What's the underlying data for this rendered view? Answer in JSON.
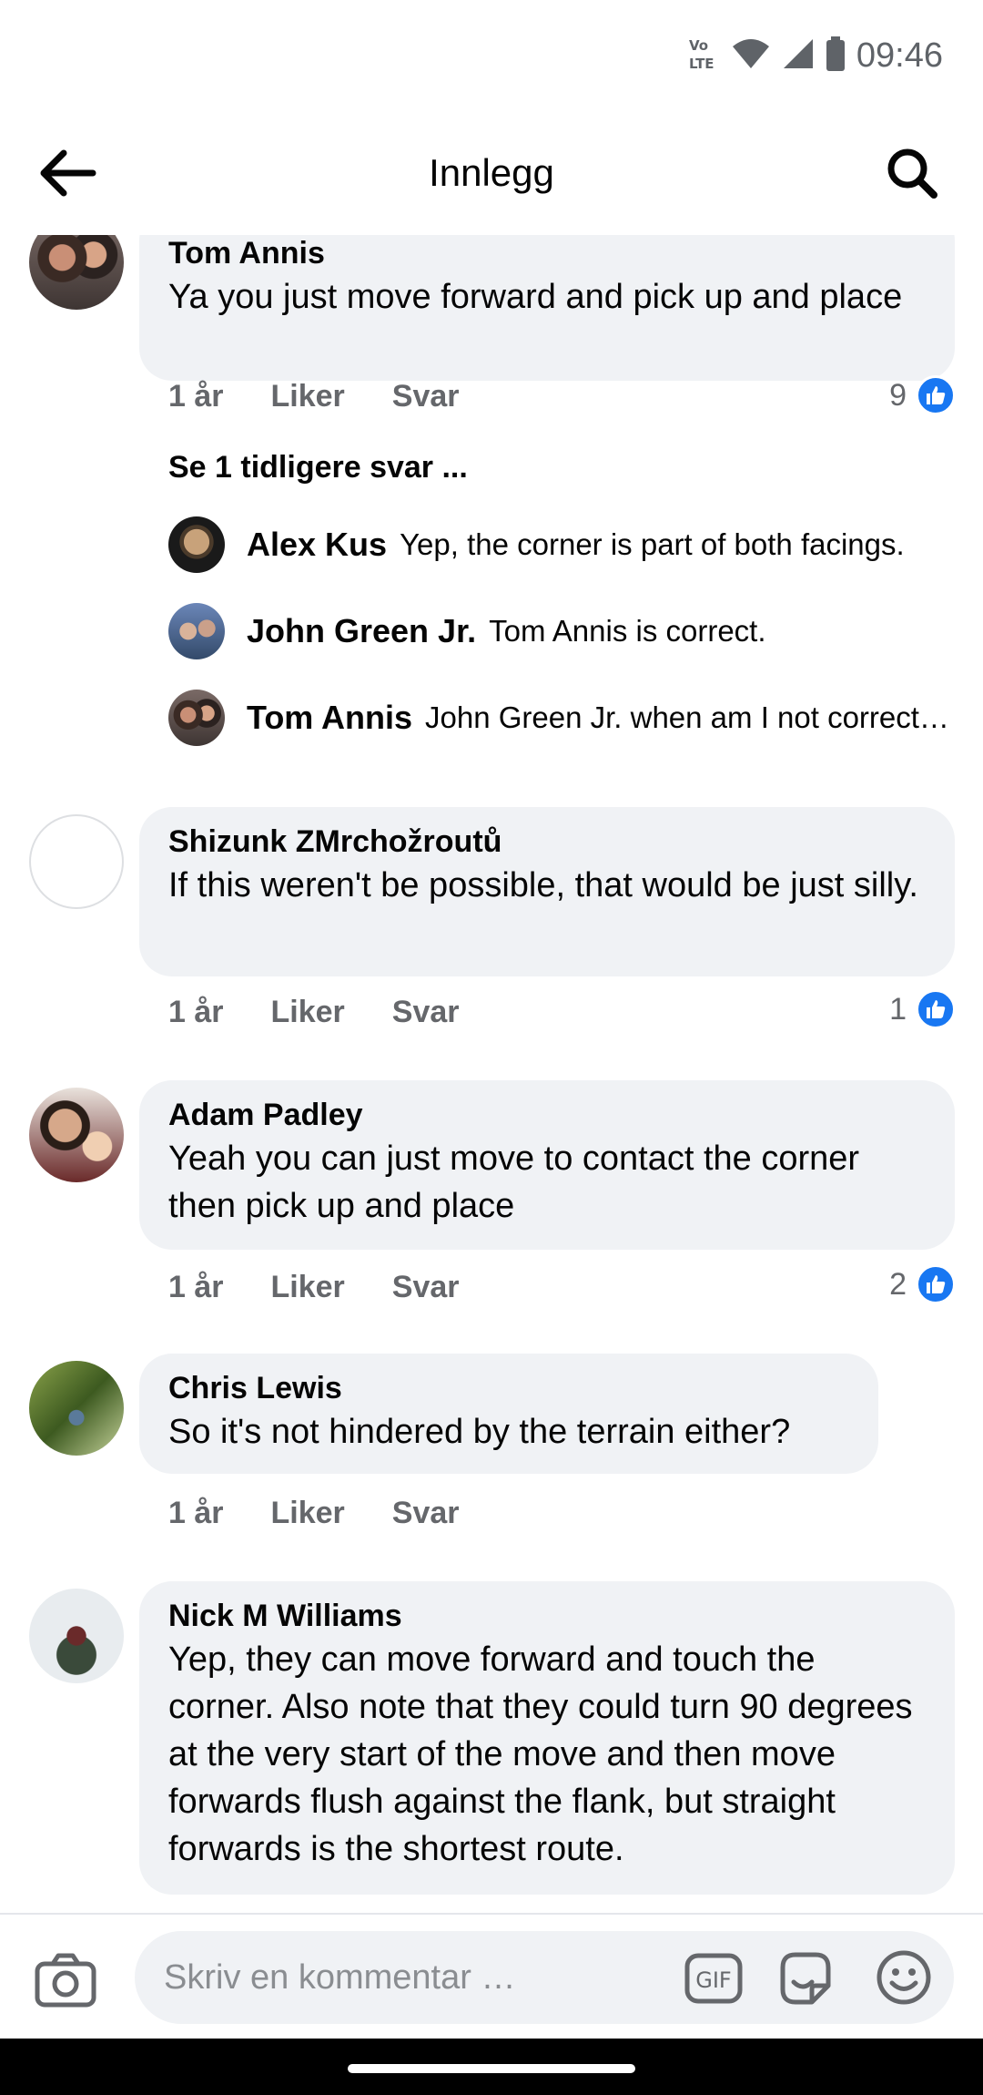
{
  "status_bar": {
    "time": "09:46",
    "network_label": "VoLTE"
  },
  "header": {
    "title": "Innlegg"
  },
  "comments": [
    {
      "name": "Tom Annis",
      "text": "Ya you just move forward and pick up and place",
      "time": "1 år",
      "like_label": "Liker",
      "reply_label": "Svar",
      "likes": "9",
      "more_replies": "Se 1 tidligere svar ...",
      "replies": [
        {
          "name": "Alex Kus",
          "text": "Yep, the corner is part of both facings."
        },
        {
          "name": "John Green Jr.",
          "text": "Tom Annis is correct."
        },
        {
          "name": "Tom Annis",
          "text": "John Green Jr. when am I not correct…"
        }
      ]
    },
    {
      "name": "Shizunk ZMrchožroutů",
      "text": "If this weren't be possible, that would be just silly.",
      "time": "1 år",
      "like_label": "Liker",
      "reply_label": "Svar",
      "likes": "1"
    },
    {
      "name": "Adam Padley",
      "text": "Yeah you can just move to contact the corner then pick up and place",
      "time": "1 år",
      "like_label": "Liker",
      "reply_label": "Svar",
      "likes": "2"
    },
    {
      "name": "Chris Lewis",
      "text": "So it's not hindered by the terrain either?",
      "time": "1 år",
      "like_label": "Liker",
      "reply_label": "Svar",
      "likes": ""
    },
    {
      "name": "Nick M Williams",
      "text": "Yep, they can move forward and touch the corner. Also note that they could turn 90 degrees at the very start of the move and then move forwards flush against the flank, but straight forwards is the shortest route.",
      "time": "",
      "like_label": "",
      "reply_label": "",
      "likes": ""
    }
  ],
  "composer": {
    "placeholder": "Skriv en kommentar …",
    "gif_label": "GIF"
  },
  "colors": {
    "accent": "#1877f2",
    "bubble": "#f0f2f5",
    "secondary_text": "#65676b"
  }
}
